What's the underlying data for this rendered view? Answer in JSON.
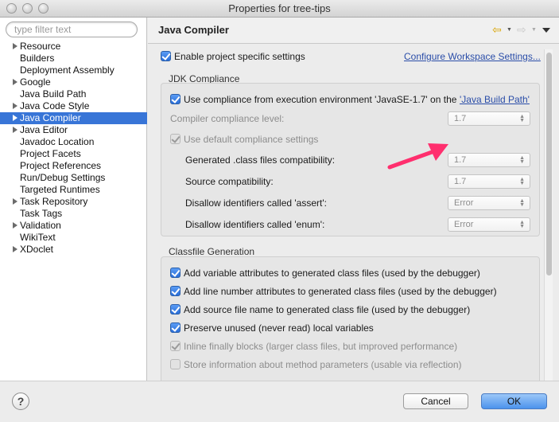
{
  "window": {
    "title": "Properties for tree-tips"
  },
  "filter": {
    "placeholder": "type filter text"
  },
  "tree": [
    {
      "label": "Resource",
      "expandable": true
    },
    {
      "label": "Builders",
      "expandable": false
    },
    {
      "label": "Deployment Assembly",
      "expandable": false
    },
    {
      "label": "Google",
      "expandable": true
    },
    {
      "label": "Java Build Path",
      "expandable": false
    },
    {
      "label": "Java Code Style",
      "expandable": true
    },
    {
      "label": "Java Compiler",
      "expandable": true,
      "selected": true
    },
    {
      "label": "Java Editor",
      "expandable": true
    },
    {
      "label": "Javadoc Location",
      "expandable": false
    },
    {
      "label": "Project Facets",
      "expandable": false
    },
    {
      "label": "Project References",
      "expandable": false
    },
    {
      "label": "Run/Debug Settings",
      "expandable": false
    },
    {
      "label": "Targeted Runtimes",
      "expandable": false
    },
    {
      "label": "Task Repository",
      "expandable": true
    },
    {
      "label": "Task Tags",
      "expandable": false
    },
    {
      "label": "Validation",
      "expandable": true
    },
    {
      "label": "WikiText",
      "expandable": false
    },
    {
      "label": "XDoclet",
      "expandable": true
    }
  ],
  "page": {
    "title": "Java Compiler",
    "enable_specific": "Enable project specific settings",
    "configure_link": "Configure Workspace Settings...",
    "jdk": {
      "title": "JDK Compliance",
      "use_compliance_prefix": "Use compliance from execution environment 'JavaSE-1.7' on the ",
      "use_compliance_link": "'Java Build Path'",
      "compliance_level_label": "Compiler compliance level:",
      "compliance_level_value": "1.7",
      "use_default": "Use default compliance settings",
      "generated_label": "Generated .class files compatibility:",
      "generated_value": "1.7",
      "source_label": "Source compatibility:",
      "source_value": "1.7",
      "assert_label": "Disallow identifiers called 'assert':",
      "assert_value": "Error",
      "enum_label": "Disallow identifiers called 'enum':",
      "enum_value": "Error"
    },
    "classfile": {
      "title": "Classfile Generation",
      "items": [
        {
          "label": "Add variable attributes to generated class files (used by the debugger)",
          "checked": true,
          "enabled": true
        },
        {
          "label": "Add line number attributes to generated class files (used by the debugger)",
          "checked": true,
          "enabled": true
        },
        {
          "label": "Add source file name to generated class file (used by the debugger)",
          "checked": true,
          "enabled": true
        },
        {
          "label": "Preserve unused (never read) local variables",
          "checked": true,
          "enabled": true
        },
        {
          "label": "Inline finally blocks (larger class files, but improved performance)",
          "checked": true,
          "enabled": false
        },
        {
          "label": "Store information about method parameters (usable via reflection)",
          "checked": false,
          "enabled": false
        }
      ]
    }
  },
  "buttons": {
    "help": "?",
    "cancel": "Cancel",
    "ok": "OK"
  },
  "colors": {
    "selection": "#3875d7",
    "annotation_arrow": "#ff2f6e",
    "ok_button": "#4c93ec"
  }
}
